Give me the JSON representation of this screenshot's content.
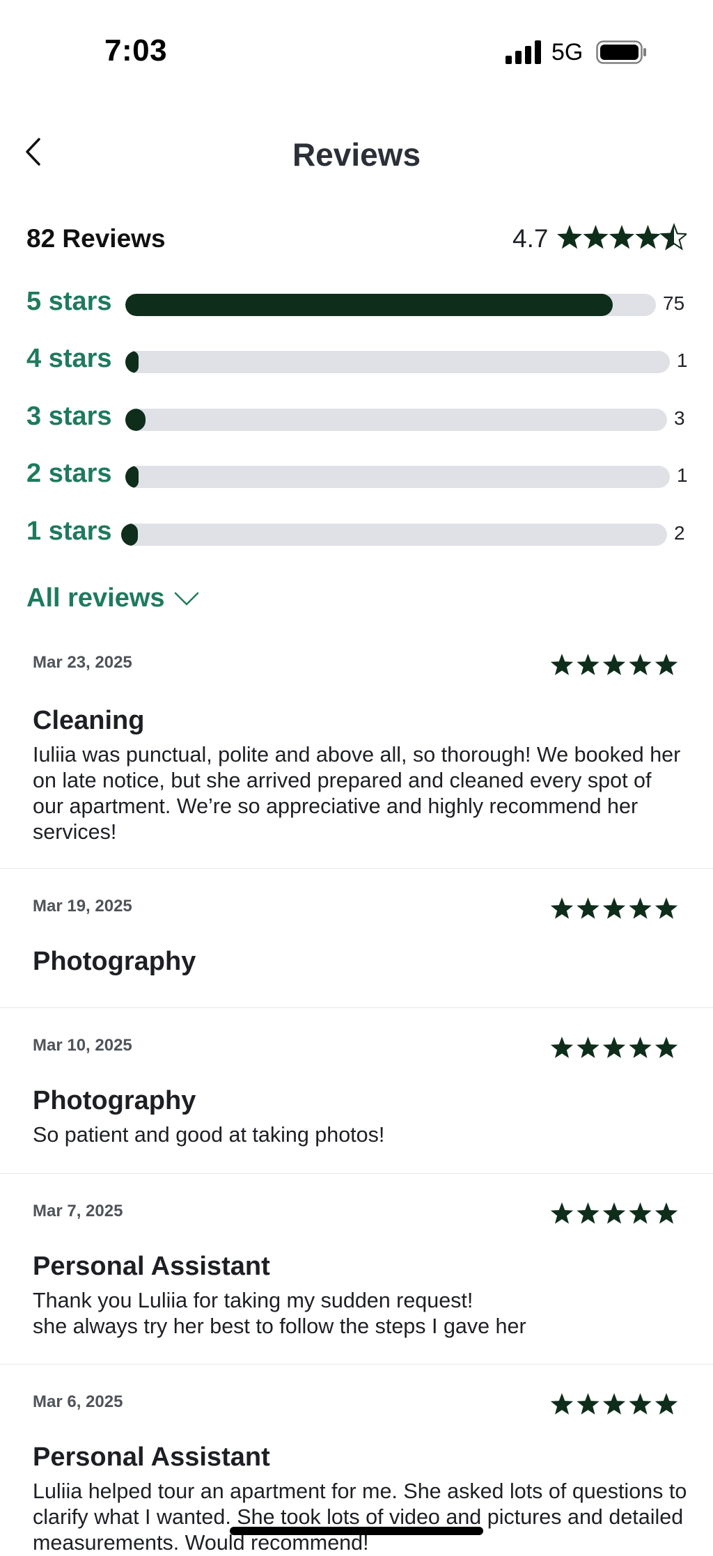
{
  "status_bar": {
    "time": "7:03",
    "network": "5G",
    "icons": [
      "signal-icon",
      "battery-icon"
    ]
  },
  "header": {
    "title": "Reviews",
    "back_icon": "chevron-left-icon"
  },
  "summary": {
    "review_count_label": "82 Reviews",
    "average": "4.7",
    "average_value": 4.7,
    "star_color": "#0e2d1b"
  },
  "distribution": [
    {
      "label": "5 stars",
      "count": "75",
      "value": 75
    },
    {
      "label": "4 stars",
      "count": "1",
      "value": 1
    },
    {
      "label": "3 stars",
      "count": "3",
      "value": 3
    },
    {
      "label": "2 stars",
      "count": "1",
      "value": 1
    },
    {
      "label": "1 stars",
      "count": "2",
      "value": 2
    }
  ],
  "filter": {
    "label": "All reviews",
    "icon": "chevron-down-icon"
  },
  "reviews": [
    {
      "date": "Mar 23, 2025",
      "rating": 5,
      "title": "Cleaning",
      "text": "Iuliia was punctual, polite and above all, so thorough! We booked her on late notice, but she arrived prepared and cleaned every spot of our apartment. We’re so appreciative and highly recommend her services!"
    },
    {
      "date": "Mar 19, 2025",
      "rating": 5,
      "title": "Photography",
      "text": ""
    },
    {
      "date": "Mar 10, 2025",
      "rating": 5,
      "title": "Photography",
      "text": "So patient and good at taking photos!"
    },
    {
      "date": "Mar 7, 2025",
      "rating": 5,
      "title": "Personal Assistant",
      "text": "Thank you Luliia for taking my sudden request!\nshe always try her best to follow the steps I gave her"
    },
    {
      "date": "Mar 6, 2025",
      "rating": 5,
      "title": "Personal Assistant",
      "text": "Luliia helped tour an apartment for me. She asked lots of questions to clarify what I wanted. She took lots of video and pictures and detailed measurements. Would recommend!"
    }
  ],
  "colors": {
    "accent": "#1e7a5e",
    "bar_fill": "#0e2d1b",
    "bar_track": "#dfe1e7"
  }
}
